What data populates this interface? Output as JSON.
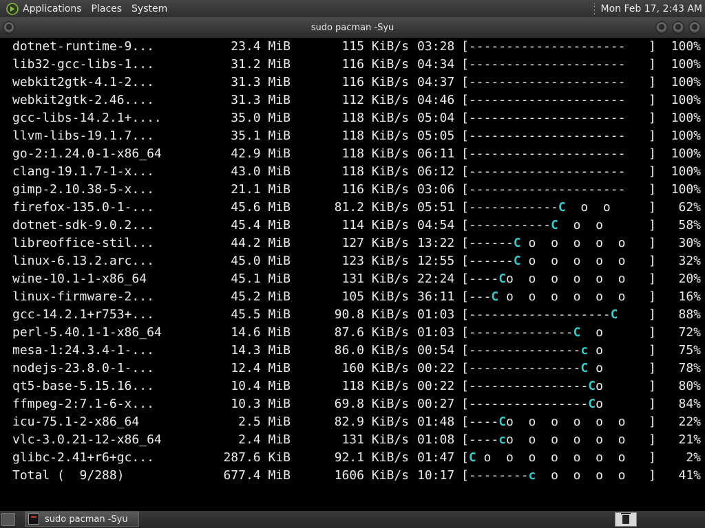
{
  "top_panel": {
    "menus": [
      "Applications",
      "Places",
      "System"
    ],
    "clock": "Mon Feb 17,  2:43 AM"
  },
  "window": {
    "title": "sudo pacman -Syu"
  },
  "taskbar": {
    "task_label": "sudo pacman -Syu"
  },
  "colors": {
    "terminal_bg": "#000000",
    "terminal_fg": "#ececec",
    "pacman_accent": "#3cc9c9"
  },
  "downloads": [
    {
      "name": "dotnet-runtime-9...",
      "size": "23.4 MiB",
      "rate": "115 KiB/s",
      "eta": "03:28",
      "pct": "100%",
      "bar": {
        "dash": "---------------------",
        "pac": "",
        "rest": ""
      }
    },
    {
      "name": "lib32-gcc-libs-1...",
      "size": "31.2 MiB",
      "rate": "116 KiB/s",
      "eta": "04:34",
      "pct": "100%",
      "bar": {
        "dash": "---------------------",
        "pac": "",
        "rest": ""
      }
    },
    {
      "name": "webkit2gtk-4.1-2...",
      "size": "31.3 MiB",
      "rate": "116 KiB/s",
      "eta": "04:37",
      "pct": "100%",
      "bar": {
        "dash": "---------------------",
        "pac": "",
        "rest": ""
      }
    },
    {
      "name": "webkit2gtk-2.46....",
      "size": "31.3 MiB",
      "rate": "112 KiB/s",
      "eta": "04:46",
      "pct": "100%",
      "bar": {
        "dash": "---------------------",
        "pac": "",
        "rest": ""
      }
    },
    {
      "name": "gcc-libs-14.2.1+....",
      "size": "35.0 MiB",
      "rate": "118 KiB/s",
      "eta": "05:04",
      "pct": "100%",
      "bar": {
        "dash": "---------------------",
        "pac": "",
        "rest": ""
      }
    },
    {
      "name": "llvm-libs-19.1.7...",
      "size": "35.1 MiB",
      "rate": "118 KiB/s",
      "eta": "05:05",
      "pct": "100%",
      "bar": {
        "dash": "---------------------",
        "pac": "",
        "rest": ""
      }
    },
    {
      "name": "go-2:1.24.0-1-x86_64",
      "size": "42.9 MiB",
      "rate": "118 KiB/s",
      "eta": "06:11",
      "pct": "100%",
      "bar": {
        "dash": "---------------------",
        "pac": "",
        "rest": ""
      }
    },
    {
      "name": "clang-19.1.7-1-x...",
      "size": "43.0 MiB",
      "rate": "118 KiB/s",
      "eta": "06:12",
      "pct": "100%",
      "bar": {
        "dash": "---------------------",
        "pac": "",
        "rest": ""
      }
    },
    {
      "name": "gimp-2.10.38-5-x...",
      "size": "21.1 MiB",
      "rate": "116 KiB/s",
      "eta": "03:06",
      "pct": "100%",
      "bar": {
        "dash": "---------------------",
        "pac": "",
        "rest": ""
      }
    },
    {
      "name": "firefox-135.0-1-...",
      "size": "45.6 MiB",
      "rate": "81.2 KiB/s",
      "eta": "05:51",
      "pct": "62%",
      "bar": {
        "dash": "------------",
        "pac": "C",
        "rest": "  o  o "
      }
    },
    {
      "name": "dotnet-sdk-9.0.2...",
      "size": "45.4 MiB",
      "rate": "114 KiB/s",
      "eta": "04:54",
      "pct": "58%",
      "bar": {
        "dash": "-----------",
        "pac": "C",
        "rest": "  o  o  "
      }
    },
    {
      "name": "libreoffice-stil...",
      "size": "44.2 MiB",
      "rate": "127 KiB/s",
      "eta": "13:22",
      "pct": "30%",
      "bar": {
        "dash": "------",
        "pac": "C",
        "rest": " o  o  o  o  o "
      }
    },
    {
      "name": "linux-6.13.2.arc...",
      "size": "45.0 MiB",
      "rate": "123 KiB/s",
      "eta": "12:55",
      "pct": "32%",
      "bar": {
        "dash": "------",
        "pac": "C",
        "rest": " o  o  o  o  o "
      }
    },
    {
      "name": "wine-10.1-1-x86_64",
      "size": "45.1 MiB",
      "rate": "131 KiB/s",
      "eta": "22:24",
      "pct": "20%",
      "bar": {
        "dash": "----",
        "pac": "C",
        "rest": "o  o  o  o  o  o "
      }
    },
    {
      "name": "linux-firmware-2...",
      "size": "45.2 MiB",
      "rate": "105 KiB/s",
      "eta": "36:11",
      "pct": "16%",
      "bar": {
        "dash": "---",
        "pac": "C",
        "rest": " o  o  o  o  o  o "
      }
    },
    {
      "name": "gcc-14.2.1+r753+...",
      "size": "45.5 MiB",
      "rate": "90.8 KiB/s",
      "eta": "01:03",
      "pct": "88%",
      "bar": {
        "dash": "-------------------",
        "pac": "C",
        "rest": " "
      }
    },
    {
      "name": "perl-5.40.1-1-x86_64",
      "size": "14.6 MiB",
      "rate": "87.6 KiB/s",
      "eta": "01:03",
      "pct": "72%",
      "bar": {
        "dash": "--------------",
        "pac": "C",
        "rest": "  o "
      }
    },
    {
      "name": "mesa-1:24.3.4-1-...",
      "size": "14.3 MiB",
      "rate": "86.0 KiB/s",
      "eta": "00:54",
      "pct": "75%",
      "bar": {
        "dash": "---------------",
        "pac": "c",
        "rest": " o "
      }
    },
    {
      "name": "nodejs-23.8.0-1-...",
      "size": "12.4 MiB",
      "rate": "160 KiB/s",
      "eta": "00:22",
      "pct": "78%",
      "bar": {
        "dash": "---------------",
        "pac": "C",
        "rest": " o "
      }
    },
    {
      "name": "qt5-base-5.15.16...",
      "size": "10.4 MiB",
      "rate": "118 KiB/s",
      "eta": "00:22",
      "pct": "80%",
      "bar": {
        "dash": "----------------",
        "pac": "C",
        "rest": "o "
      }
    },
    {
      "name": "ffmpeg-2:7.1-6-x...",
      "size": "10.3 MiB",
      "rate": "69.8 KiB/s",
      "eta": "00:27",
      "pct": "84%",
      "bar": {
        "dash": "----------------",
        "pac": "C",
        "rest": "o "
      }
    },
    {
      "name": "icu-75.1-2-x86_64",
      "size": "2.5 MiB",
      "rate": "82.9 KiB/s",
      "eta": "01:48",
      "pct": "22%",
      "bar": {
        "dash": "----",
        "pac": "C",
        "rest": "o  o  o  o  o  o "
      }
    },
    {
      "name": "vlc-3.0.21-12-x86_64",
      "size": "2.4 MiB",
      "rate": "131 KiB/s",
      "eta": "01:08",
      "pct": "21%",
      "bar": {
        "dash": "----",
        "pac": "c",
        "rest": "o  o  o  o  o  o "
      }
    },
    {
      "name": "glibc-2.41+r6+gc...",
      "size": "287.6 KiB",
      "rate": "92.1 KiB/s",
      "eta": "01:47",
      "pct": "2%",
      "bar": {
        "dash": "",
        "pac": "C",
        "rest": " o  o  o  o  o  o  o "
      }
    },
    {
      "name": "Total (  9/288)",
      "size": "677.4 MiB",
      "rate": "1606 KiB/s",
      "eta": "10:17",
      "pct": "41%",
      "bar": {
        "dash": "--------",
        "pac": "c",
        "rest": "  o  o  o  o "
      }
    }
  ]
}
